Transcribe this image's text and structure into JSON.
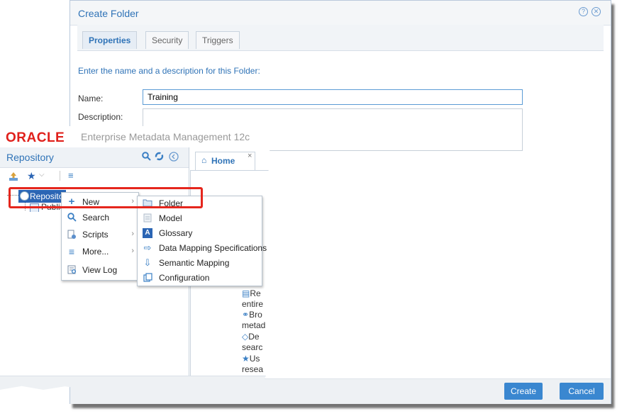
{
  "dialog": {
    "title": "Create Folder",
    "tabs": [
      {
        "label": "Properties",
        "active": true
      },
      {
        "label": "Security",
        "active": false
      },
      {
        "label": "Triggers",
        "active": false
      }
    ],
    "instruction": "Enter the name and a description for this Folder:",
    "name_label": "Name:",
    "name_value": "Training",
    "description_label": "Description:",
    "description_value": "",
    "create_button": "Create",
    "cancel_button": "Cancel"
  },
  "app": {
    "logo_text": "ORACLE",
    "product_name": "Enterprise Metadata Management 12c",
    "repository_panel": {
      "title": "Repository",
      "tree_root": "Repository",
      "tree_child": "Public"
    },
    "home_tab": {
      "label": "Home"
    },
    "home_snippets": [
      "Re",
      "entire",
      "Bro",
      "metad",
      "De",
      "searc",
      "Us",
      "resea"
    ]
  },
  "context_menu": {
    "items": [
      {
        "label": "New",
        "icon": "plus-icon",
        "submenu": true
      },
      {
        "label": "Search",
        "icon": "search-icon",
        "submenu": false
      },
      {
        "label": "Scripts",
        "icon": "scripts-icon",
        "submenu": true
      },
      {
        "label": "More...",
        "icon": "list-icon",
        "submenu": true
      },
      {
        "label": "View Log",
        "icon": "log-icon",
        "submenu": false
      }
    ]
  },
  "new_submenu": {
    "items": [
      {
        "label": "Folder",
        "icon": "folder-icon"
      },
      {
        "label": "Model",
        "icon": "model-icon"
      },
      {
        "label": "Glossary",
        "icon": "glossary-icon"
      },
      {
        "label": "Data Mapping Specifications",
        "icon": "data-mapping-icon"
      },
      {
        "label": "Semantic Mapping",
        "icon": "semantic-mapping-icon"
      },
      {
        "label": "Configuration",
        "icon": "configuration-icon"
      }
    ]
  },
  "colors": {
    "accent": "#2f73b7",
    "brand": "#e0201b",
    "button": "#3a87d0",
    "highlight": "#e5261d",
    "selection": "#2b65b4"
  }
}
